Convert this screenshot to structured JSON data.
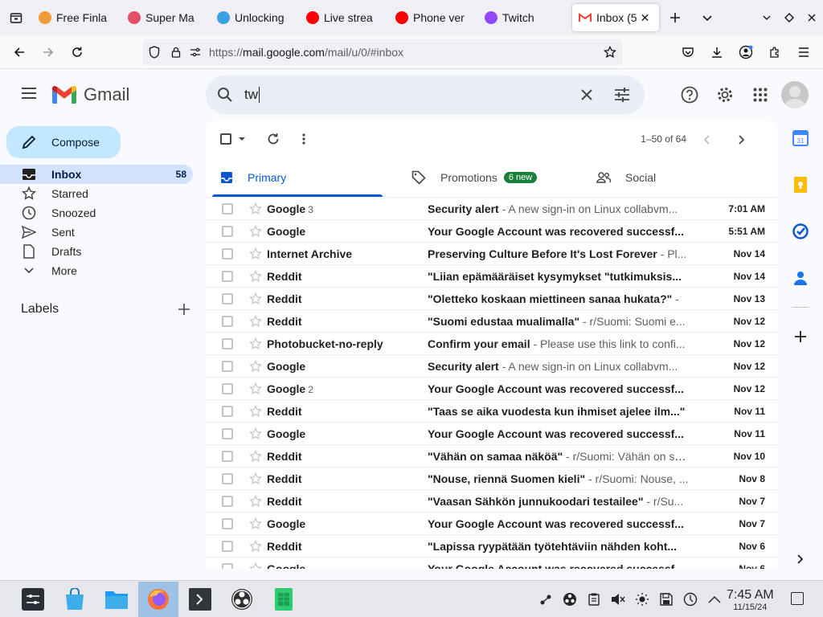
{
  "browser": {
    "tabs": [
      {
        "label": "Free Finla",
        "favicon_color": "#f29b3a",
        "favicon": "orange-face-favicon"
      },
      {
        "label": "Super Ma",
        "favicon_color": "#e44f6b",
        "favicon": "chrome-like-favicon"
      },
      {
        "label": "Unlocking",
        "favicon_color": "#3aa0e6",
        "favicon": "blue-circle-favicon"
      },
      {
        "label": "Live strea",
        "favicon_color": "#ff0000",
        "favicon": "youtube-favicon"
      },
      {
        "label": "Phone ver",
        "favicon_color": "#ff0000",
        "favicon": "youtube-favicon"
      },
      {
        "label": "Twitch",
        "favicon_color": "#9146ff",
        "favicon": "twitch-favicon"
      }
    ],
    "active_tab": {
      "label": "Inbox (5",
      "favicon": "gmail-favicon"
    },
    "url_prefix": "https://",
    "url_host": "mail.google.com",
    "url_path": "/mail/u/0/#inbox"
  },
  "gmail": {
    "logo_text": "Gmail",
    "search_value": "tw",
    "compose_label": "Compose",
    "nav": [
      {
        "label": "Inbox",
        "count": "58",
        "icon": "inbox-icon",
        "active": true
      },
      {
        "label": "Starred",
        "count": "",
        "icon": "star-icon"
      },
      {
        "label": "Snoozed",
        "count": "",
        "icon": "clock-icon"
      },
      {
        "label": "Sent",
        "count": "",
        "icon": "send-icon"
      },
      {
        "label": "Drafts",
        "count": "",
        "icon": "draft-icon"
      },
      {
        "label": "More",
        "count": "",
        "icon": "chevron-down-icon"
      }
    ],
    "labels_header": "Labels",
    "pager": "1–50 of 64",
    "categories": [
      {
        "label": "Primary",
        "icon": "inbox-tab-icon",
        "badge": ""
      },
      {
        "label": "Promotions",
        "icon": "tag-icon",
        "badge": "6 new"
      },
      {
        "label": "Social",
        "icon": "people-icon",
        "badge": ""
      }
    ],
    "emails": [
      {
        "sender": "Google",
        "count": "3",
        "subject": "Security alert",
        "snippet": " - A new sign-in on Linux collabvm...",
        "date": "7:01 AM"
      },
      {
        "sender": "Google",
        "count": "",
        "subject": "Your Google Account was recovered successf...",
        "snippet": "",
        "date": "5:51 AM"
      },
      {
        "sender": "Internet Archive",
        "count": "",
        "subject": "Preserving Culture Before It's Lost Forever",
        "snippet": " - Pl...",
        "date": "Nov 14"
      },
      {
        "sender": "Reddit",
        "count": "",
        "subject": "\"Liian epämääräiset kysymykset \"tutkimuksis...",
        "snippet": "",
        "date": "Nov 14"
      },
      {
        "sender": "Reddit",
        "count": "",
        "subject": "\"Oletteko koskaan miettineen sanaa hukata?\"",
        "snippet": " -",
        "date": "Nov 13"
      },
      {
        "sender": "Reddit",
        "count": "",
        "subject": "\"Suomi edustaa mualimalla\"",
        "snippet": " - r/Suomi: Suomi e...",
        "date": "Nov 12"
      },
      {
        "sender": "Photobucket-no-reply",
        "count": "",
        "subject": "Confirm your email",
        "snippet": " - Please use this link to confi...",
        "date": "Nov 12"
      },
      {
        "sender": "Google",
        "count": "",
        "subject": "Security alert",
        "snippet": " - A new sign-in on Linux collabvm...",
        "date": "Nov 12"
      },
      {
        "sender": "Google",
        "count": "2",
        "subject": "Your Google Account was recovered successf...",
        "snippet": "",
        "date": "Nov 12"
      },
      {
        "sender": "Reddit",
        "count": "",
        "subject": "\"Taas se aika vuodesta kun ihmiset ajelee ilm...\"",
        "snippet": "",
        "date": "Nov 11"
      },
      {
        "sender": "Google",
        "count": "",
        "subject": "Your Google Account was recovered successf...",
        "snippet": "",
        "date": "Nov 11"
      },
      {
        "sender": "Reddit",
        "count": "",
        "subject": "\"Vähän on samaa näköä\"",
        "snippet": " - r/Suomi: Vähän on sa...",
        "date": "Nov 10"
      },
      {
        "sender": "Reddit",
        "count": "",
        "subject": "\"Nouse, riennä Suomen kieli\"",
        "snippet": " - r/Suomi: Nouse, ...",
        "date": "Nov 8"
      },
      {
        "sender": "Reddit",
        "count": "",
        "subject": "\"Vaasan Sähkön junnukoodari testailee\"",
        "snippet": " - r/Su...",
        "date": "Nov 7"
      },
      {
        "sender": "Google",
        "count": "",
        "subject": "Your Google Account was recovered successf...",
        "snippet": "",
        "date": "Nov 7"
      },
      {
        "sender": "Reddit",
        "count": "",
        "subject": "\"Lapissa ryypätään työtehtäviin nähden koht...",
        "snippet": "",
        "date": "Nov 6"
      },
      {
        "sender": "Google",
        "count": "",
        "subject": "Your Google Account was recovered successf...",
        "snippet": "",
        "date": "Nov 6"
      }
    ]
  },
  "taskbar": {
    "time": "7:45 AM",
    "date": "11/15/24"
  },
  "colors": {
    "accent": "#0b57d0",
    "compose_bg": "#c2e7ff",
    "active_nav": "#d3e3fd",
    "badge_green": "#188038"
  }
}
